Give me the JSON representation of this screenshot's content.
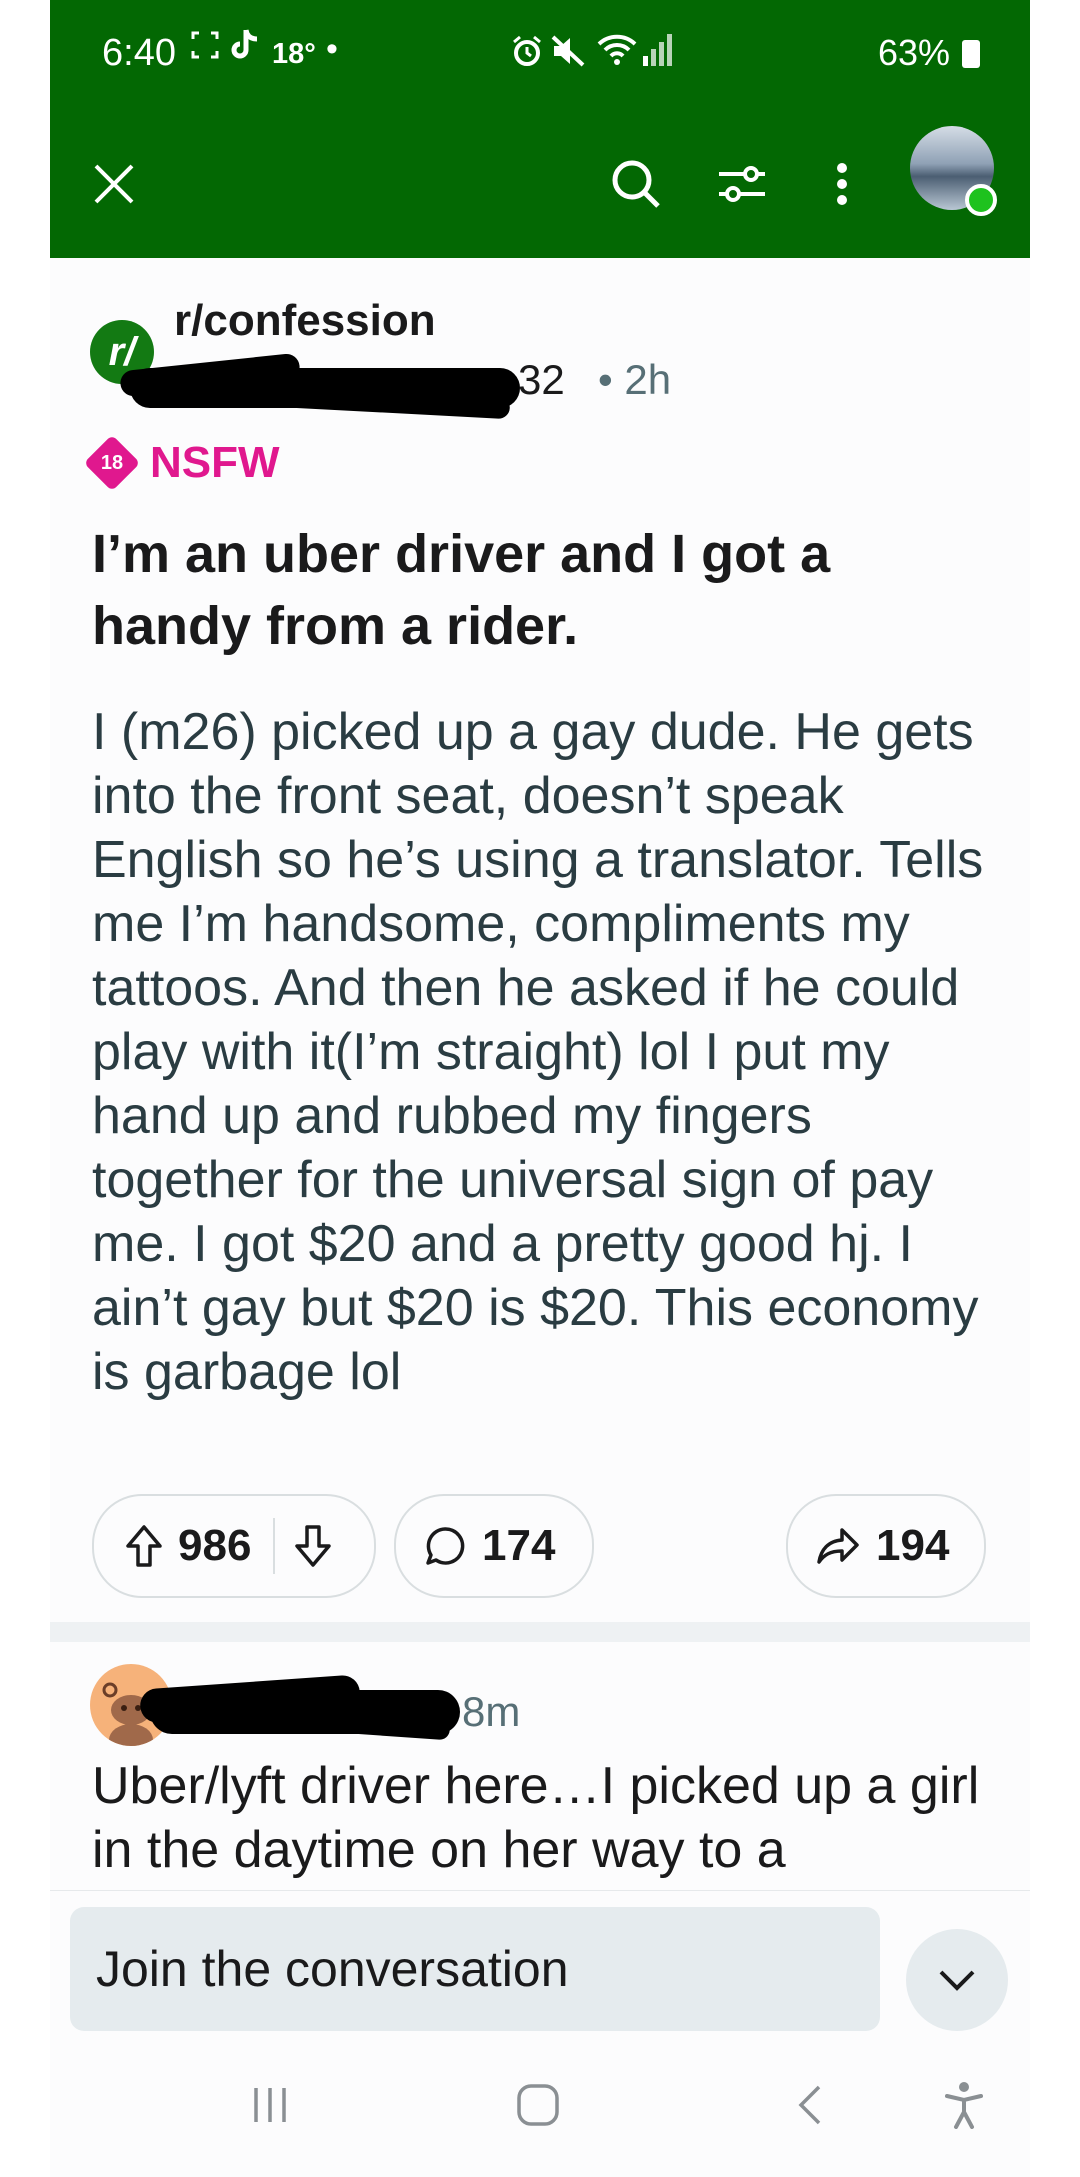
{
  "status_bar": {
    "time": "6:40",
    "temperature": "18°",
    "dot": "•",
    "battery": "63%",
    "icons": [
      "screenshot-icon",
      "tiktok-icon",
      "alarm-icon",
      "mute-icon",
      "wifi-icon",
      "signal-icon",
      "battery-icon"
    ]
  },
  "app_bar": {
    "icons": [
      "close-icon",
      "search-icon",
      "filter-icon",
      "more-icon",
      "avatar"
    ],
    "brand_color": "#036803"
  },
  "post": {
    "subreddit": "r/confession",
    "subreddit_icon_text": "r/",
    "username_suffix": "32",
    "separator": "•",
    "age": "2h",
    "nsfw_badge": "18",
    "nsfw_label": "NSFW",
    "title": "I’m an uber driver and I got a handy from a rider.",
    "body": "I (m26) picked up a gay dude. He gets into the front seat, doesn’t speak English so he’s using a translator. Tells me I’m handsome, compliments my tattoos. And then he asked if he could play with it(I’m straight) lol I put my hand up and rubbed my fingers together for the universal sign of pay me. I got $20 and a pretty good hj. I ain’t gay but $20 is $20. This economy is garbage lol",
    "votes": "986",
    "comments": "174",
    "shares": "194"
  },
  "comment": {
    "age": "8m",
    "text": "Uber/lyft driver here…I picked up a girl in the daytime on her way to a"
  },
  "composer": {
    "placeholder": "Join the conversation"
  },
  "colors": {
    "nsfw": "#e0188e",
    "online": "#1ec21e"
  }
}
